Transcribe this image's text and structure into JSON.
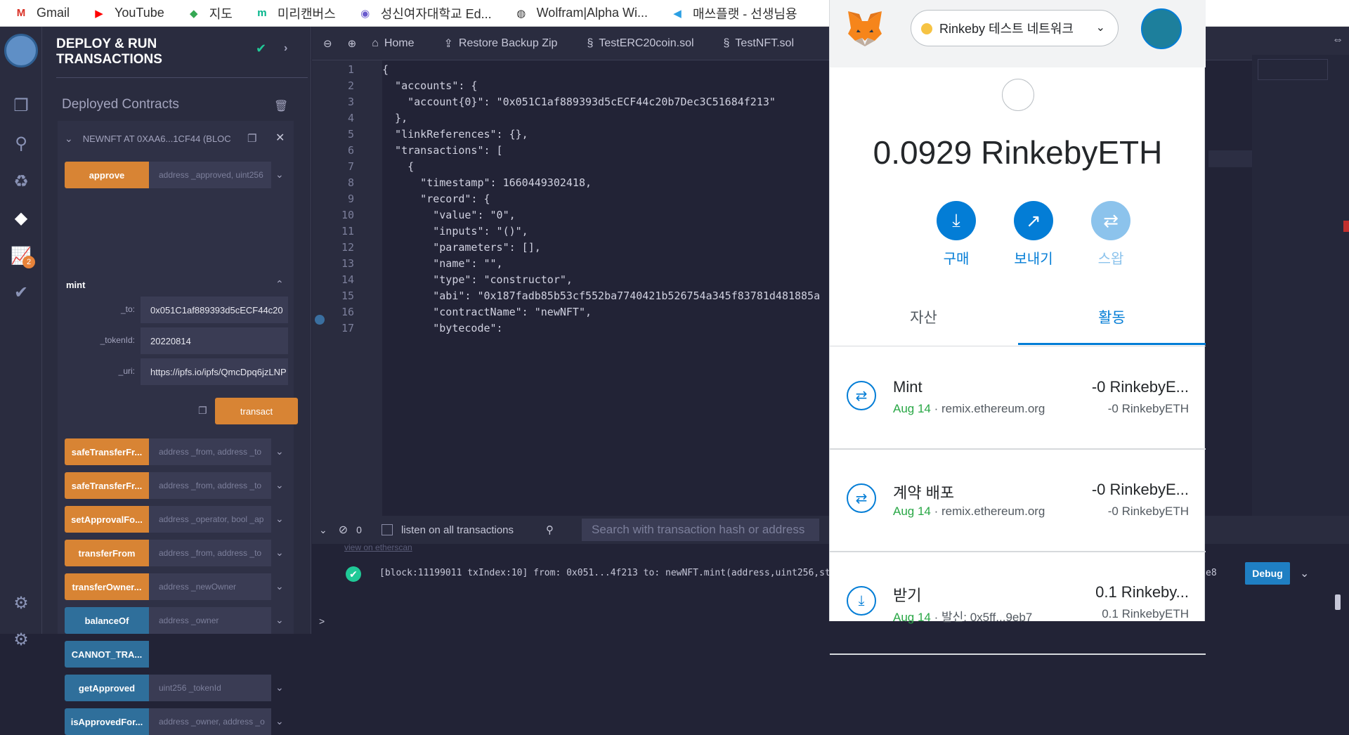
{
  "bookmarks": [
    {
      "label": "Gmail",
      "icon": "gmail-icon",
      "glyph": "M",
      "color": "#d93025"
    },
    {
      "label": "YouTube",
      "icon": "youtube-icon",
      "glyph": "▶",
      "color": "#ff0000"
    },
    {
      "label": "지도",
      "icon": "maps-icon",
      "glyph": "◆",
      "color": "#34a853"
    },
    {
      "label": "미리캔버스",
      "icon": "miricanvas-icon",
      "glyph": "m",
      "color": "#00b48a"
    },
    {
      "label": "성신여자대학교 Ed...",
      "icon": "university-icon",
      "glyph": "◉",
      "color": "#6a5acd"
    },
    {
      "label": "Wolfram|Alpha Wi...",
      "icon": "wolfram-icon",
      "glyph": "◍",
      "color": "#333333"
    },
    {
      "label": "매쓰플랫 - 선생님용",
      "icon": "mathflat-icon",
      "glyph": "◀",
      "color": "#2b9fe3"
    }
  ],
  "panel": {
    "title_line1": "DEPLOY & RUN",
    "title_line2": "TRANSACTIONS",
    "deployed_title": "Deployed Contracts",
    "contract_name": "NEWNFT AT 0XAA6...1CF44 (BLOC",
    "mint_label": "mint",
    "transact_label": "transact",
    "functions_top": [
      {
        "name": "approve",
        "placeholder": "address _approved, uint256",
        "style": "orange"
      }
    ],
    "mint_params": [
      {
        "label": "_to:",
        "value": "0x051C1af889393d5cECF44c20"
      },
      {
        "label": "_tokenId:",
        "value": "20220814"
      },
      {
        "label": "_uri:",
        "value": "https://ipfs.io/ipfs/QmcDpq6jzLNP"
      }
    ],
    "functions": [
      {
        "name": "safeTransferFr...",
        "placeholder": "address _from, address _to",
        "style": "orange"
      },
      {
        "name": "safeTransferFr...",
        "placeholder": "address _from, address _to",
        "style": "orange"
      },
      {
        "name": "setApprovalFo...",
        "placeholder": "address _operator, bool _ap",
        "style": "orange"
      },
      {
        "name": "transferFrom",
        "placeholder": "address _from, address _to",
        "style": "orange"
      },
      {
        "name": "transferOwner...",
        "placeholder": "address _newOwner",
        "style": "orange"
      },
      {
        "name": "balanceOf",
        "placeholder": "address _owner",
        "style": "blue"
      },
      {
        "name": "CANNOT_TRA...",
        "placeholder": "",
        "style": "blue"
      },
      {
        "name": "getApproved",
        "placeholder": "uint256 _tokenId",
        "style": "blue"
      },
      {
        "name": "isApprovedFor...",
        "placeholder": "address _owner, address _o",
        "style": "blue"
      }
    ],
    "badge_count": "2"
  },
  "editor": {
    "tabs": [
      {
        "label": "Home",
        "icon": "home-icon"
      },
      {
        "label": "Restore Backup Zip",
        "icon": "upload-icon"
      },
      {
        "label": "TestERC20coin.sol",
        "icon": "solidity-icon"
      },
      {
        "label": "TestNFT.sol",
        "icon": "solidity-icon"
      }
    ],
    "lines": [
      "{",
      "  \"accounts\": {",
      "    \"account{0}\": \"0x051C1af889393d5cECF44c20b7Dec3C51684f213\"",
      "  },",
      "  \"linkReferences\": {},",
      "  \"transactions\": [",
      "    {",
      "      \"timestamp\": 1660449302418,",
      "      \"record\": {",
      "        \"value\": \"0\",",
      "        \"inputs\": \"()\",",
      "        \"parameters\": [],",
      "        \"name\": \"\",",
      "        \"type\": \"constructor\",",
      "        \"abi\": \"0x187fadb85b53cf552ba7740421b526754a345f83781d481885a",
      "        \"contractName\": \"newNFT\",",
      "        \"bytecode\":"
    ]
  },
  "terminal": {
    "count": "0",
    "listen_label": "listen on all transactions",
    "search_placeholder": "Search with transaction hash or address",
    "log_line": "[block:11199011 txIndex:10] from: 0x051...4f213 to: newNFT.mint(address,uint256,string",
    "log_tail": "e8",
    "debug_label": "Debug",
    "prompt": ">",
    "link_partial": "view on etherscan"
  },
  "metamask": {
    "network": "Rinkeby 테스트 네트워크",
    "balance": "0.0929 RinkebyETH",
    "actions": [
      {
        "label": "구매",
        "icon": "download-icon",
        "glyph": "⤓",
        "disabled": false
      },
      {
        "label": "보내기",
        "icon": "send-arrow-icon",
        "glyph": "↗",
        "disabled": false
      },
      {
        "label": "스왑",
        "icon": "swap-icon",
        "glyph": "⇄",
        "disabled": true
      }
    ],
    "tabs": [
      "자산",
      "활동"
    ],
    "transactions": [
      {
        "name": "Mint",
        "date": "Aug 14",
        "origin": " · remix.ethereum.org",
        "amount": "-0 RinkebyE...",
        "amount2": "-0 RinkebyETH",
        "icon": "swap-arrows-icon",
        "glyph": "⇄"
      },
      {
        "name": "계약 배포",
        "date": "Aug 14",
        "origin": " · remix.ethereum.org",
        "amount": "-0 RinkebyE...",
        "amount2": "-0 RinkebyETH",
        "icon": "swap-arrows-icon",
        "glyph": "⇄"
      },
      {
        "name": "받기",
        "date": "Aug 14",
        "origin": " · 발신: 0x5ff...9eb7",
        "amount": "0.1 Rinkeby...",
        "amount2": "0.1 RinkebyETH",
        "icon": "receive-icon",
        "glyph": "⤓"
      }
    ]
  }
}
